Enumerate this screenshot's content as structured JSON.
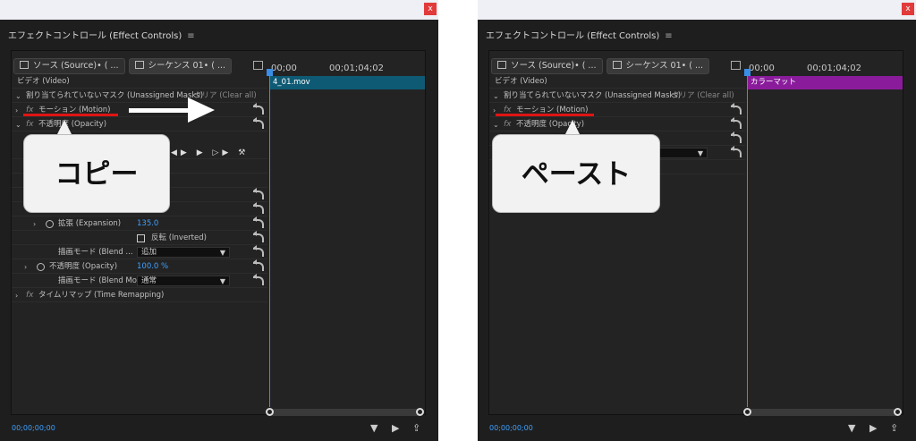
{
  "close_label": "x",
  "panel_title": "エフェクトコントロール (Effect Controls)",
  "menu_icon": "≡",
  "source_tab": "ソース (Source)• ( ...",
  "sequence_tab": "シーケンス 01• ( ...",
  "ruler_start": "00;00",
  "ruler_mid": "00;01;04;02",
  "video_header": "ビデオ (Video)",
  "mask_row": "割り当てられていないマスク (Unassigned Masks)",
  "clear_all": "クリア (Clear all)",
  "motion": "モーション (Motion)",
  "opacity_header": "不透明度 (Opacity)",
  "expansion_label": "拡張 (Expansion)",
  "expansion_value": "135.0",
  "inverted_label": "反転 (Inverted)",
  "blend_short": "描画モード (Blend ...",
  "blend_add_value": "追加",
  "opacity_label": "不透明度 (Opacity)",
  "opacity_value": "100.0 %",
  "blend_long": "描画モード (Blend Mo...",
  "blend_normal_value": "通常",
  "time_remap": "タイムリマップ (Time Remapping)",
  "timecode": "00;00;00;00",
  "left_clip": "4_01.mov",
  "right_clip": "カラーマット",
  "left_bubble": "コピー",
  "right_bubble": "ペースト",
  "fx_label": "fx",
  "colors": {
    "left_clip": "#0e5a74",
    "right_clip": "#8a1c9c",
    "annotation_red": "#e01414",
    "value_blue": "#3ea0ff"
  }
}
